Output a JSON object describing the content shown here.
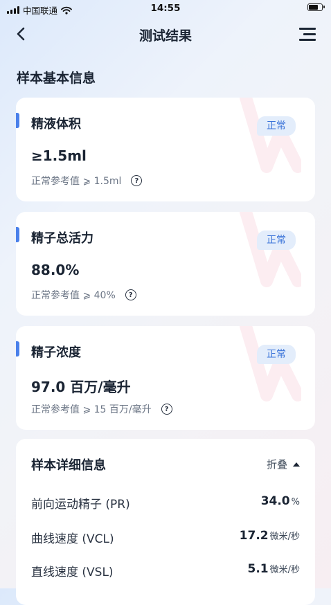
{
  "status_bar": {
    "carrier": "中国联通",
    "time": "14:55"
  },
  "nav": {
    "title": "测试结果"
  },
  "section_title": "样本基本信息",
  "cards": [
    {
      "name": "精液体积",
      "badge": "正常",
      "value": "≥1.5ml",
      "ref": "正常参考值 ⩾ 1.5ml"
    },
    {
      "name": "精子总活力",
      "badge": "正常",
      "value": "88.0%",
      "ref": "正常参考值 ⩾ 40%"
    },
    {
      "name": "精子浓度",
      "badge": "正常",
      "value": "97.0 百万/毫升",
      "ref": "正常参考值 ⩾ 15 百万/毫升"
    }
  ],
  "detail": {
    "title": "样本详细信息",
    "fold_label": "折叠",
    "rows": [
      {
        "label": "前向运动精子 (PR)",
        "value": "34.0",
        "unit": "%"
      },
      {
        "label": "曲线速度 (VCL)",
        "value": "17.2",
        "unit": "微米/秒"
      },
      {
        "label": "直线速度 (VSL)",
        "value": "5.1",
        "unit": "微米/秒"
      }
    ]
  },
  "colors": {
    "accent": "#4a80ea",
    "badge_bg": "#e3edfb",
    "badge_text": "#3a73d9"
  }
}
